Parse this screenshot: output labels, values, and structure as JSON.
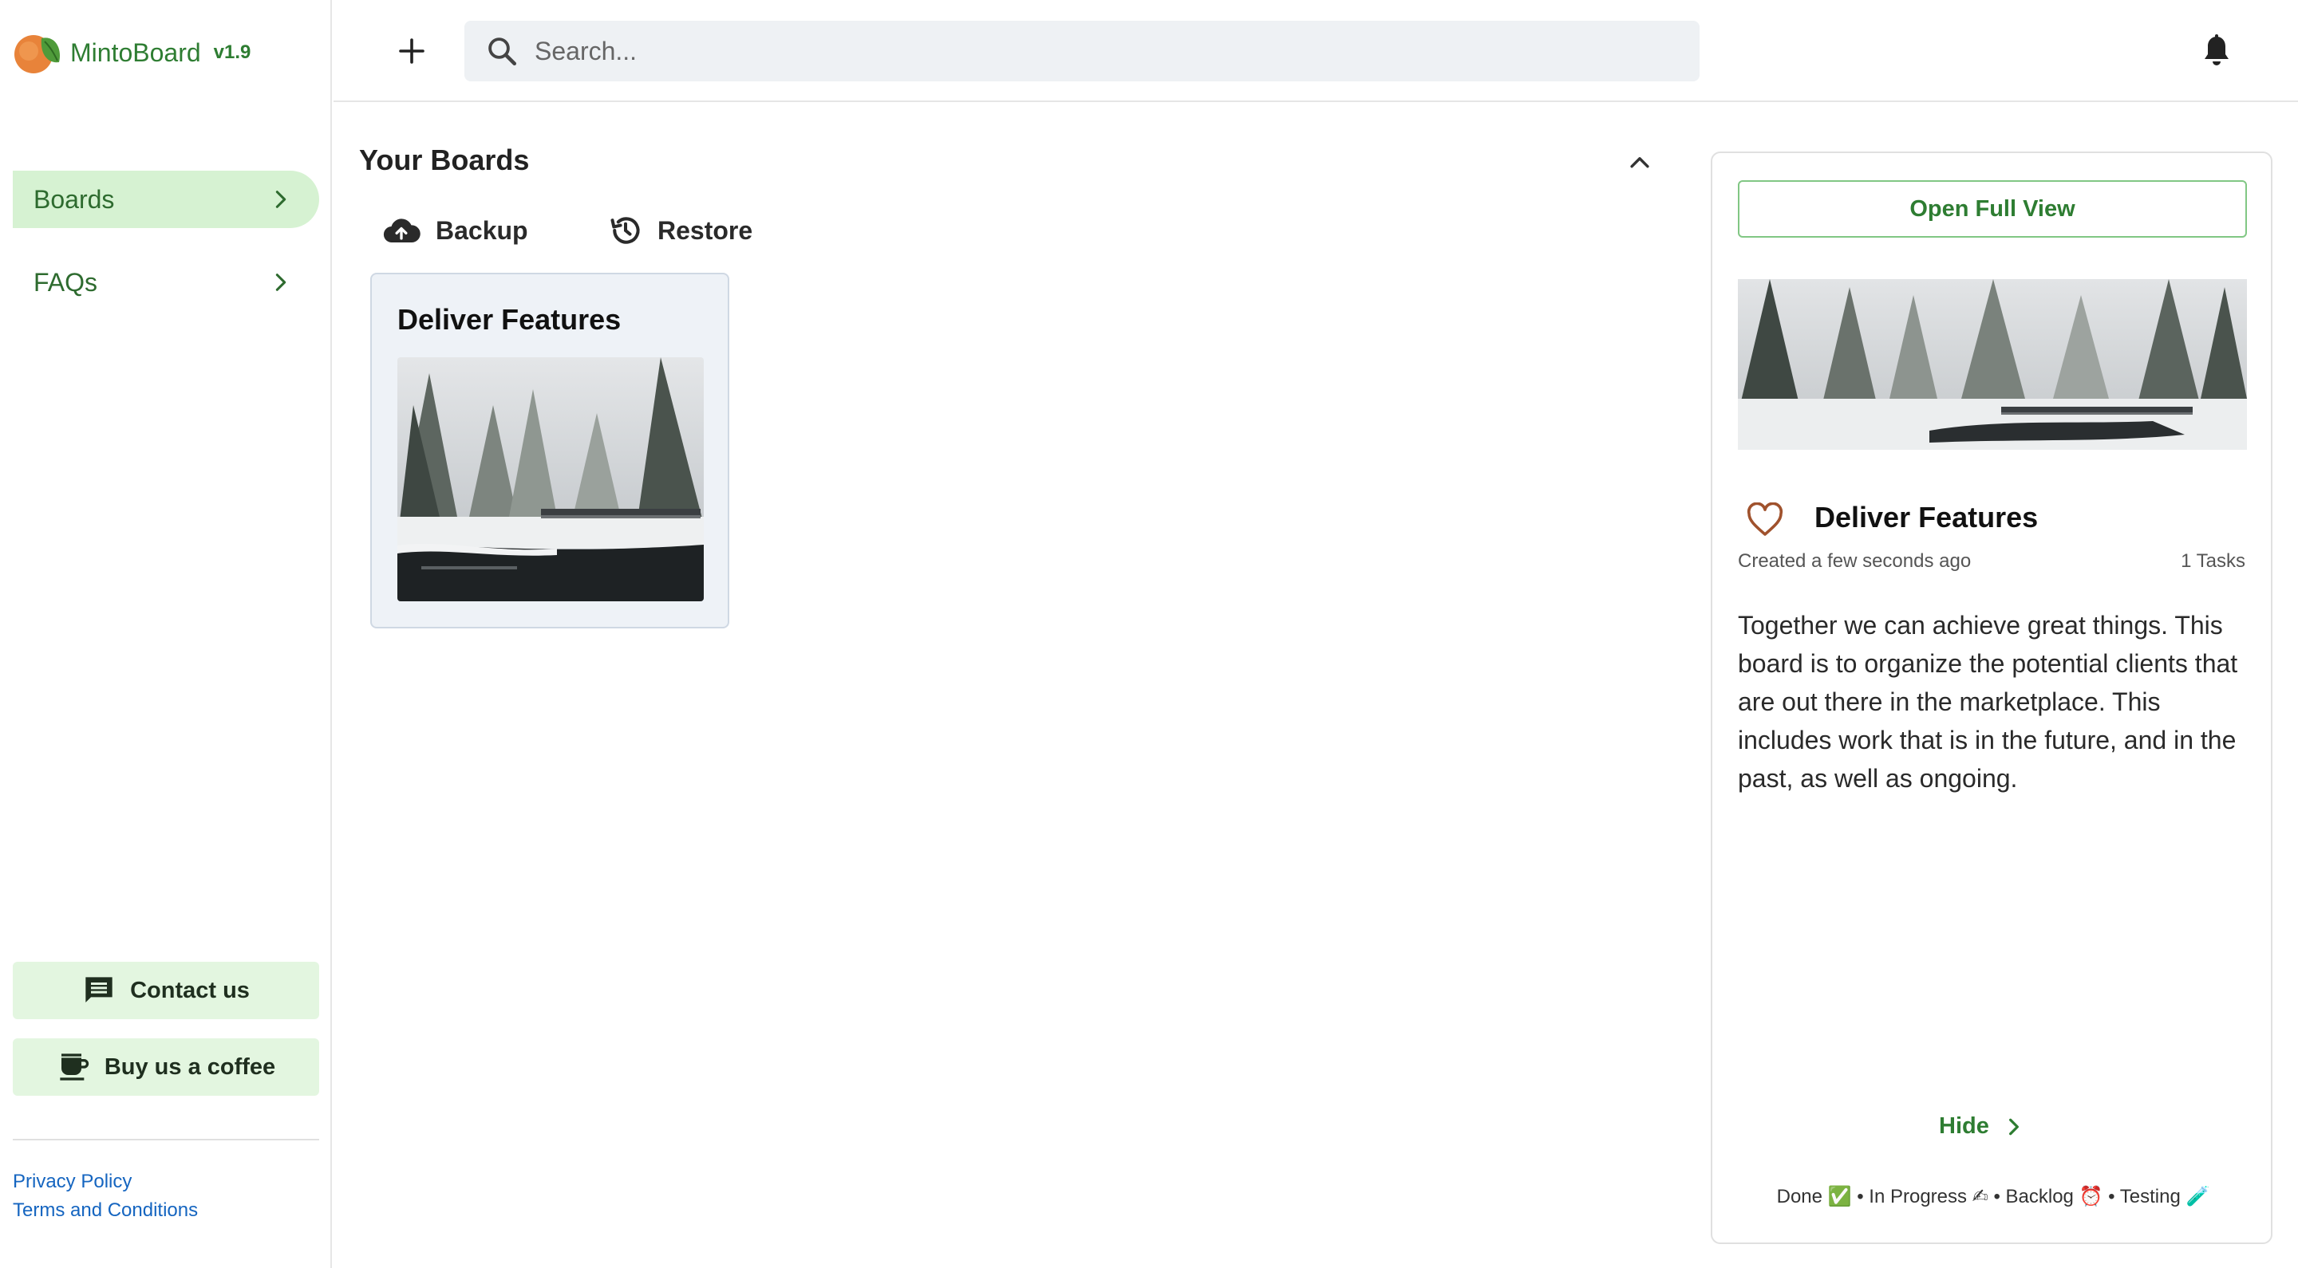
{
  "brand": {
    "name": "MintoBoard",
    "version": "v1.9"
  },
  "sidebar": {
    "items": [
      {
        "label": "Boards",
        "active": true
      },
      {
        "label": "FAQs",
        "active": false
      }
    ],
    "contact_label": "Contact us",
    "coffee_label": "Buy us a coffee",
    "privacy_label": "Privacy Policy",
    "terms_label": "Terms and Conditions"
  },
  "topbar": {
    "search_placeholder": "Search..."
  },
  "main": {
    "section_title": "Your Boards",
    "backup_label": "Backup",
    "restore_label": "Restore",
    "boards": [
      {
        "title": "Deliver Features"
      }
    ]
  },
  "panel": {
    "open_full_label": "Open Full View",
    "title": "Deliver Features",
    "created": "Created a few seconds ago",
    "tasks": "1 Tasks",
    "description": "Together we can achieve great things. This board is to organize the potential clients that are out there in the marketplace. This includes work that is in the future, and in the past, as well as ongoing.",
    "hide_label": "Hide",
    "legend": "Done ✅ • In Progress ✍ • Backlog ⏰ • Testing 🧪"
  },
  "colors": {
    "accent": "#2e7d32",
    "active_nav_bg": "#d6f2d2",
    "button_bg": "#e3f6e0",
    "link": "#1565c0"
  }
}
